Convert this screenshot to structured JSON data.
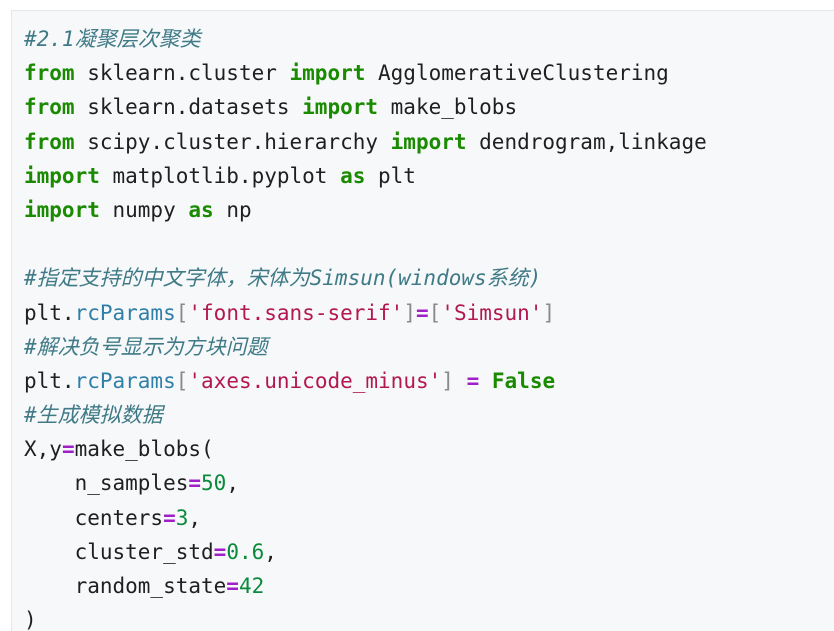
{
  "code": {
    "lines": [
      [
        {
          "c": "cm",
          "t": "#2.1凝聚层次聚类"
        }
      ],
      [
        {
          "c": "kw",
          "t": "from"
        },
        {
          "c": "txt",
          "t": " sklearn.cluster "
        },
        {
          "c": "kw",
          "t": "import"
        },
        {
          "c": "txt",
          "t": " AgglomerativeClustering"
        }
      ],
      [
        {
          "c": "kw",
          "t": "from"
        },
        {
          "c": "txt",
          "t": " sklearn.datasets "
        },
        {
          "c": "kw",
          "t": "import"
        },
        {
          "c": "txt",
          "t": " make_blobs"
        }
      ],
      [
        {
          "c": "kw",
          "t": "from"
        },
        {
          "c": "txt",
          "t": " scipy.cluster.hierarchy "
        },
        {
          "c": "kw",
          "t": "import"
        },
        {
          "c": "txt",
          "t": " dendrogram,linkage"
        }
      ],
      [
        {
          "c": "kw",
          "t": "import"
        },
        {
          "c": "txt",
          "t": " matplotlib.pyplot "
        },
        {
          "c": "kw",
          "t": "as"
        },
        {
          "c": "txt",
          "t": " plt"
        }
      ],
      [
        {
          "c": "kw",
          "t": "import"
        },
        {
          "c": "txt",
          "t": " numpy "
        },
        {
          "c": "kw",
          "t": "as"
        },
        {
          "c": "txt",
          "t": " np"
        }
      ],
      [],
      [
        {
          "c": "cm",
          "t": "#指定支持的中文字体，宋体为Simsun(windows系统)"
        }
      ],
      [
        {
          "c": "txt",
          "t": "plt."
        },
        {
          "c": "attr",
          "t": "rcParams"
        },
        {
          "c": "br",
          "t": "["
        },
        {
          "c": "str",
          "t": "'font.sans-serif'"
        },
        {
          "c": "br",
          "t": "]"
        },
        {
          "c": "op",
          "t": "="
        },
        {
          "c": "br",
          "t": "["
        },
        {
          "c": "str",
          "t": "'Simsun'"
        },
        {
          "c": "br",
          "t": "]"
        }
      ],
      [
        {
          "c": "cm",
          "t": "#解决负号显示为方块问题"
        }
      ],
      [
        {
          "c": "txt",
          "t": "plt."
        },
        {
          "c": "attr",
          "t": "rcParams"
        },
        {
          "c": "br",
          "t": "["
        },
        {
          "c": "str",
          "t": "'axes.unicode_minus'"
        },
        {
          "c": "br",
          "t": "]"
        },
        {
          "c": "txt",
          "t": " "
        },
        {
          "c": "op",
          "t": "="
        },
        {
          "c": "txt",
          "t": " "
        },
        {
          "c": "kw",
          "t": "False"
        }
      ],
      [
        {
          "c": "cm",
          "t": "#生成模拟数据"
        }
      ],
      [
        {
          "c": "txt",
          "t": "X,y"
        },
        {
          "c": "op",
          "t": "="
        },
        {
          "c": "txt",
          "t": "make_blobs("
        }
      ],
      [
        {
          "c": "txt",
          "t": "    n_samples"
        },
        {
          "c": "op",
          "t": "="
        },
        {
          "c": "num",
          "t": "50"
        },
        {
          "c": "txt",
          "t": ","
        }
      ],
      [
        {
          "c": "txt",
          "t": "    centers"
        },
        {
          "c": "op",
          "t": "="
        },
        {
          "c": "num",
          "t": "3"
        },
        {
          "c": "txt",
          "t": ","
        }
      ],
      [
        {
          "c": "txt",
          "t": "    cluster_std"
        },
        {
          "c": "op",
          "t": "="
        },
        {
          "c": "num",
          "t": "0.6"
        },
        {
          "c": "txt",
          "t": ","
        }
      ],
      [
        {
          "c": "txt",
          "t": "    random_state"
        },
        {
          "c": "op",
          "t": "="
        },
        {
          "c": "num",
          "t": "42"
        }
      ],
      [
        {
          "c": "txt",
          "t": ")"
        }
      ]
    ]
  }
}
